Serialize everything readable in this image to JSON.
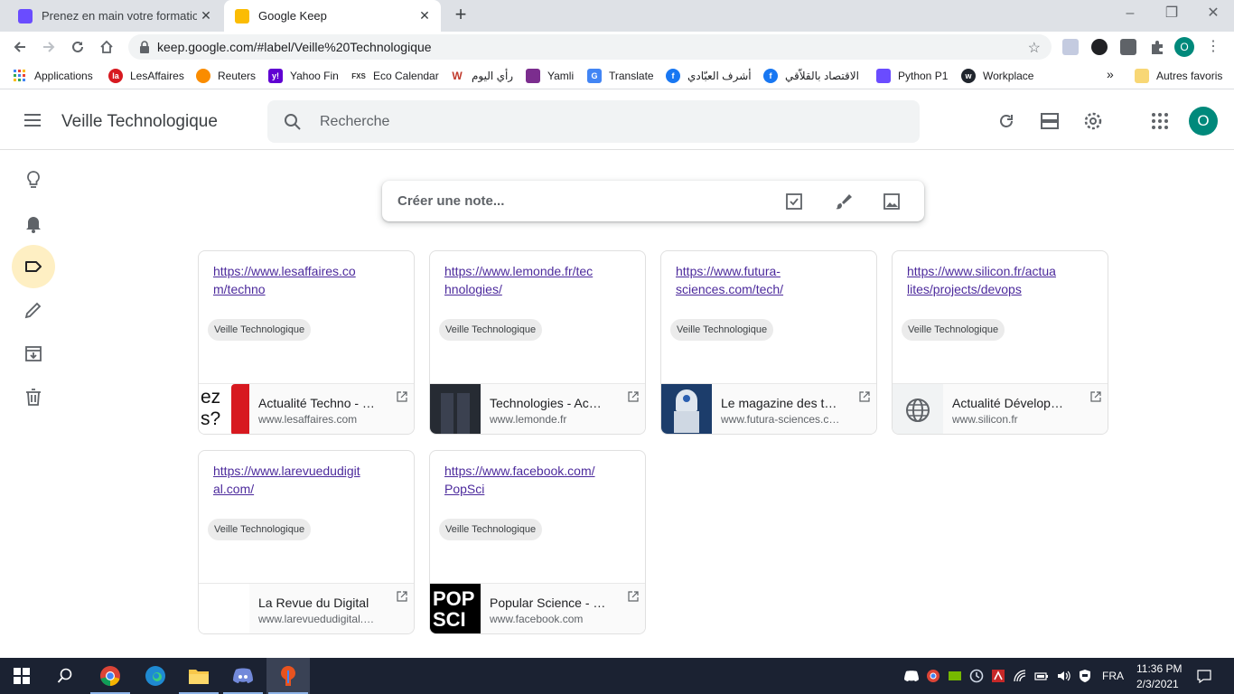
{
  "browser": {
    "tabs": [
      {
        "title": "Prenez en main votre formation |",
        "favicon_color": "#6a4cff"
      },
      {
        "title": "Google Keep",
        "favicon_color": "#fbbc04"
      }
    ],
    "url": "keep.google.com/#label/Veille%20Technologique",
    "profile_initial": "O",
    "bookmarks": [
      {
        "label": "Applications",
        "icon": "apps-grid-icon"
      },
      {
        "label": "LesAffaires",
        "icon": "lesaffaires-icon"
      },
      {
        "label": "Reuters",
        "icon": "reuters-icon"
      },
      {
        "label": "Yahoo Fin",
        "icon": "yahoo-icon"
      },
      {
        "label": "Eco Calendar",
        "icon": "fxs-icon"
      },
      {
        "label": "رأي اليوم",
        "icon": "raialyoum-icon"
      },
      {
        "label": "Yamli",
        "icon": "yamli-icon"
      },
      {
        "label": "Translate",
        "icon": "translate-icon"
      },
      {
        "label": "أشرف العبّادي",
        "icon": "facebook-icon"
      },
      {
        "label": "الاقتصاد بالقلاّقي",
        "icon": "facebook-icon"
      },
      {
        "label": "Python P1",
        "icon": "openclassrooms-icon"
      },
      {
        "label": "Workplace",
        "icon": "workplace-icon"
      }
    ],
    "bookmarks_more": "»",
    "other_bookmarks": "Autres favoris"
  },
  "keep": {
    "title": "Veille Technologique",
    "search_placeholder": "Recherche",
    "avatar_initial": "O",
    "create_note_placeholder": "Créer une note...",
    "notes": [
      {
        "link": "https://www.lesaffaires.com/techno",
        "link_lines": [
          "https://www.lesaffaires.co",
          "m/techno"
        ],
        "label": "Veille Technologique",
        "preview_title": "Actualité Techno - …",
        "preview_domain": "www.lesaffaires.com",
        "thumb": "lesaffaires"
      },
      {
        "link": "https://www.lemonde.fr/technologies/",
        "link_lines": [
          "https://www.lemonde.fr/tec",
          "hnologies/"
        ],
        "label": "Veille Technologique",
        "preview_title": "Technologies - Ac…",
        "preview_domain": "www.lemonde.fr",
        "thumb": "lemonde"
      },
      {
        "link": "https://www.futura-sciences.com/tech/",
        "link_lines": [
          "https://www.futura-",
          "sciences.com/tech/"
        ],
        "label": "Veille Technologique",
        "preview_title": "Le magazine des t…",
        "preview_domain": "www.futura-sciences.c…",
        "thumb": "futura"
      },
      {
        "link": "https://www.silicon.fr/actualites/projects/devops",
        "link_lines": [
          "https://www.silicon.fr/actua",
          "lites/projects/devops"
        ],
        "label": "Veille Technologique",
        "preview_title": "Actualité Dévelop…",
        "preview_domain": "www.silicon.fr",
        "thumb": "globe"
      },
      {
        "link": "https://www.larevuedudigital.com/",
        "link_lines": [
          "https://www.larevuedudigit",
          "al.com/"
        ],
        "label": "Veille Technologique",
        "preview_title": "La Revue du Digital",
        "preview_domain": "www.larevuedudigital.…",
        "thumb": "blank"
      },
      {
        "link": "https://www.facebook.com/PopSci",
        "link_lines": [
          "https://www.facebook.com/",
          "PopSci"
        ],
        "label": "Veille Technologique",
        "preview_title": "Popular Science - …",
        "preview_domain": "www.facebook.com",
        "thumb": "popsci",
        "thumb_text": [
          "POP",
          "SCI"
        ]
      }
    ],
    "thumb_text_lesaffaires": [
      "ez",
      "s?"
    ]
  },
  "taskbar": {
    "language": "FRA",
    "time": "11:36 PM",
    "date": "2/3/2021"
  },
  "colors": {
    "keep_active": "#feefc3",
    "link": "#4c2a9c",
    "avatar": "#00897b",
    "taskbar": "#1b2232"
  }
}
